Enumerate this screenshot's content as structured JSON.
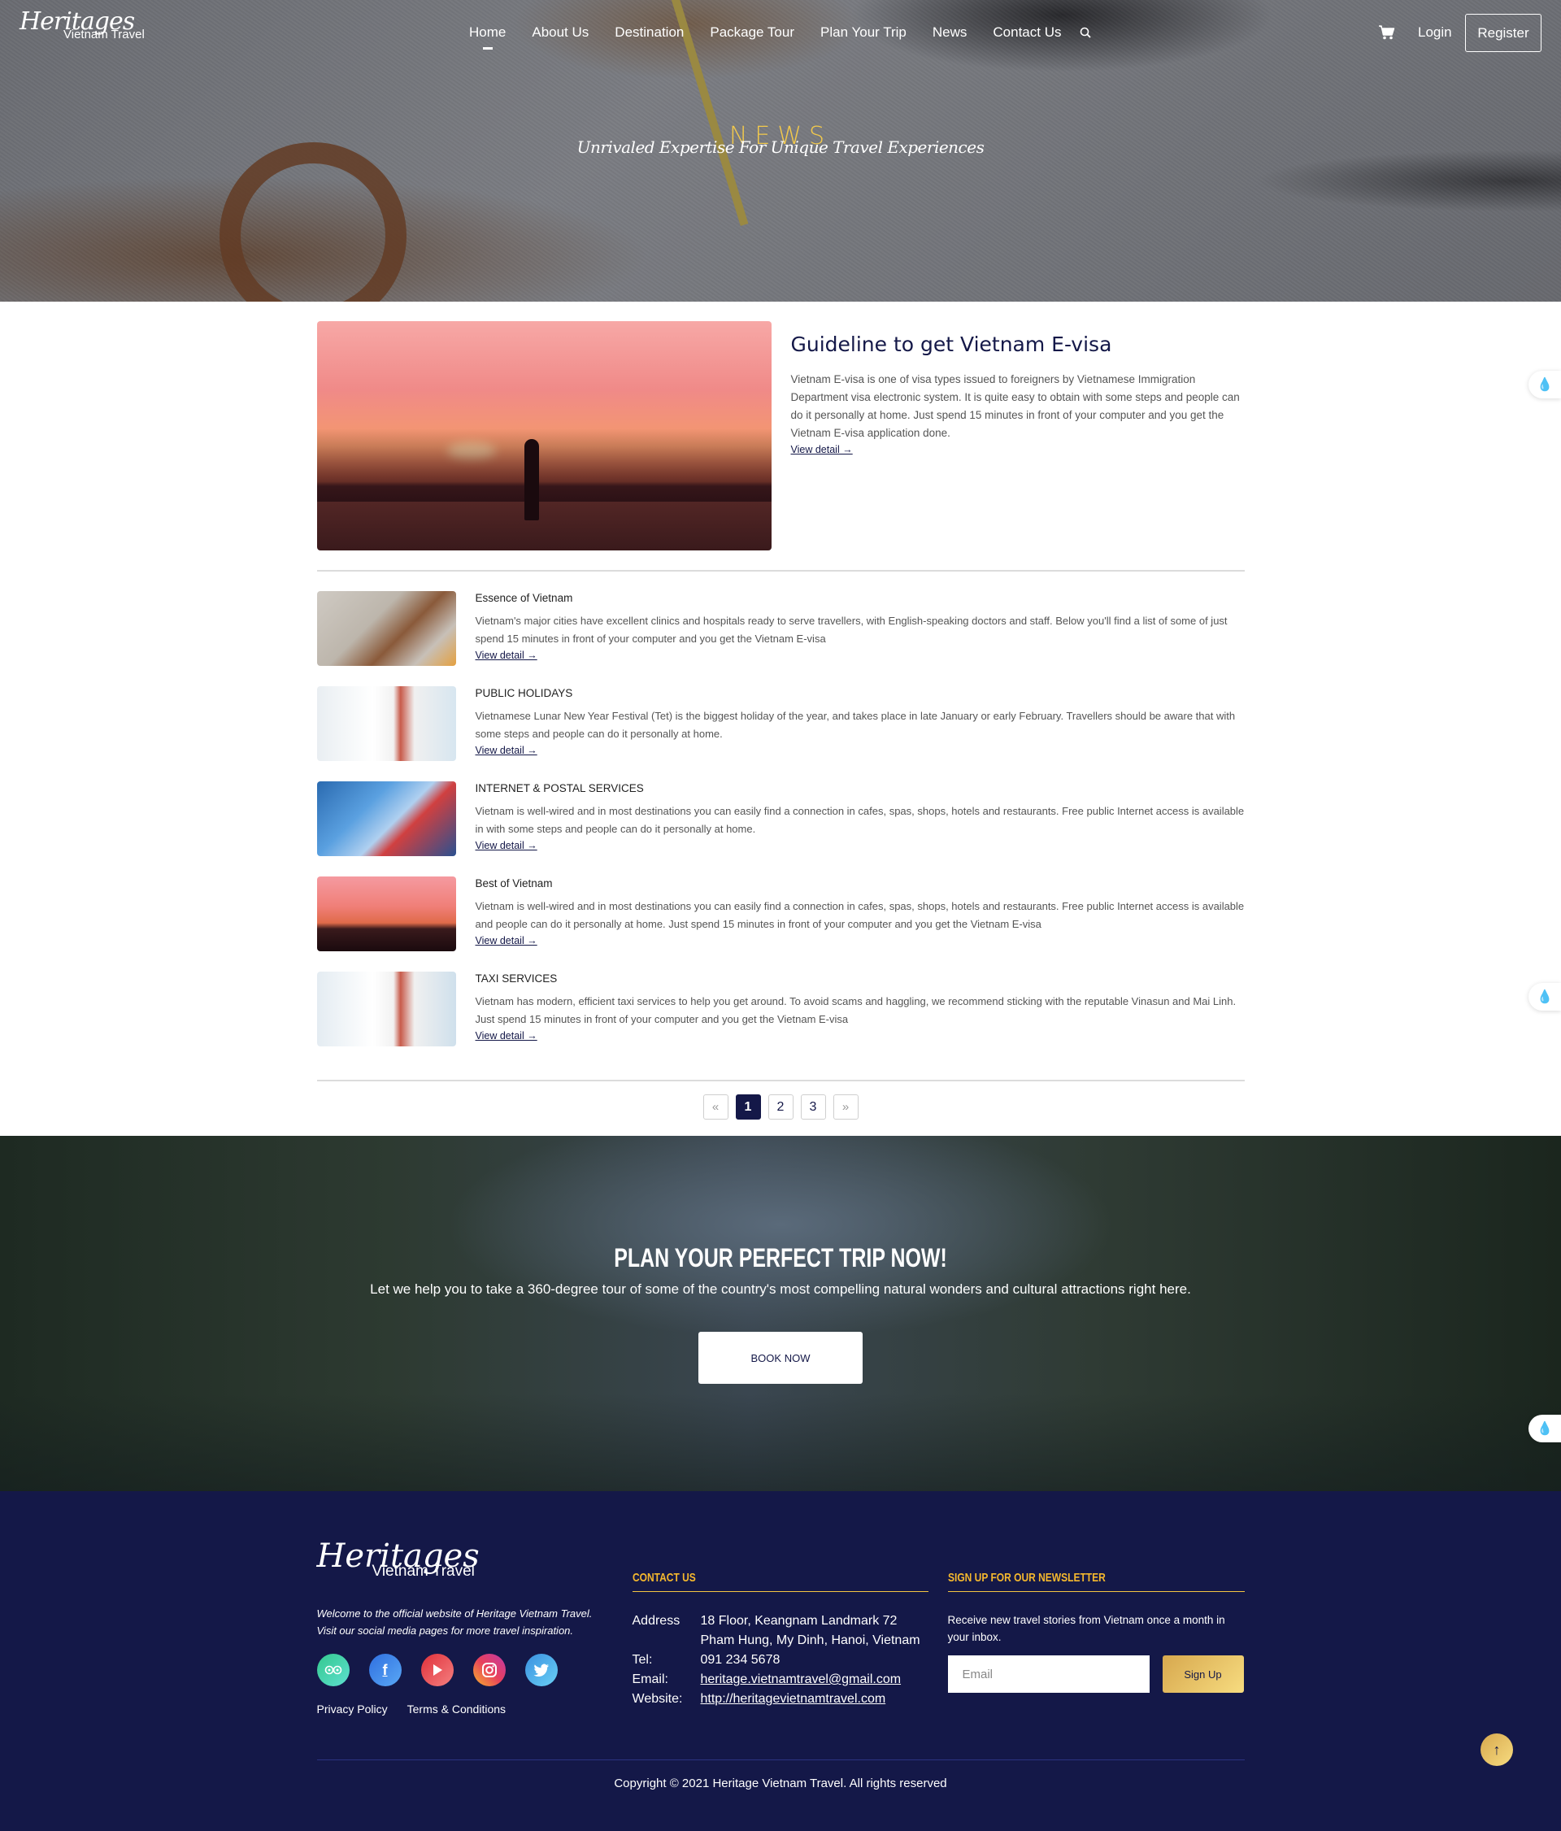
{
  "brand": {
    "script": "Heritages",
    "sub": "Vietnam Travel"
  },
  "nav": {
    "items": [
      {
        "label": "Home",
        "active": true
      },
      {
        "label": "About Us"
      },
      {
        "label": "Destination"
      },
      {
        "label": "Package Tour"
      },
      {
        "label": "Plan Your Trip"
      },
      {
        "label": "News"
      },
      {
        "label": "Contact Us"
      }
    ],
    "search_icon": "search-icon",
    "cart_icon": "cart-icon",
    "login": "Login",
    "register": "Register"
  },
  "hero": {
    "title": "NEWS",
    "subtitle": "Unrivaled Expertise For Unique Travel Experiences"
  },
  "featured": {
    "title": "Guideline to get Vietnam E-visa",
    "text": "Vietnam E-visa is one of visa types issued to foreigners by Vietnamese Immigration Department visa electronic system. It is quite easy to obtain with some steps and people can do it personally at home. Just spend 15 minutes in front of your computer and you get the Vietnam E-visa application done.",
    "link": "View detail →"
  },
  "articles": [
    {
      "title": "Essence of Vietnam",
      "text": "Vietnam's major cities have excellent clinics and hospitals ready to serve travellers, with English-speaking doctors and staff. Below you'll find a list of some of just spend 15 minutes in front of your computer and you get the Vietnam E-visa",
      "link": "View detail →"
    },
    {
      "title": "PUBLIC HOLIDAYS",
      "text": "Vietnamese Lunar New Year Festival (Tet) is the biggest holiday of the year, and takes place in late January or early February. Travellers should be aware that with some steps and people can do it personally at home.",
      "link": "View detail →"
    },
    {
      "title": "INTERNET & POSTAL SERVICES",
      "text": "Vietnam is well-wired and in most destinations you can easily find a connection in cafes, spas, shops, hotels and restaurants. Free public Internet access is available in with some steps and people can do it personally at home.",
      "link": "View detail →"
    },
    {
      "title": "Best of Vietnam",
      "text": "Vietnam is well-wired and in most destinations you can easily find a connection in cafes, spas, shops, hotels and restaurants. Free public Internet access is available and people can do it personally at home. Just spend 15 minutes in front of your computer and you get the Vietnam E-visa",
      "link": "View detail →"
    },
    {
      "title": "TAXI SERVICES",
      "text": "Vietnam has modern, efficient taxi services to help you get around. To avoid scams and haggling, we recommend sticking with the reputable Vinasun and Mai Linh. Just spend 15 minutes in front of your computer and you get the Vietnam E-visa",
      "link": "View detail →"
    }
  ],
  "pagination": {
    "prev": "«",
    "pages": [
      "1",
      "2",
      "3"
    ],
    "current": "1",
    "next": "»"
  },
  "cta": {
    "title": "PLAN YOUR PERFECT TRIP NOW!",
    "text": "Let we help you to take a 360-degree tour of some of the country's most compelling natural wonders and cultural attractions right here.",
    "button": "BOOK NOW"
  },
  "footer": {
    "welcome_line1": "Welcome to the official website of Heritage Vietnam Travel.",
    "welcome_line2": "Visit our social media pages for more travel inspiration.",
    "socials": [
      "tripadvisor-icon",
      "facebook-icon",
      "youtube-icon",
      "instagram-icon",
      "twitter-icon"
    ],
    "privacy": "Privacy Policy",
    "terms": "Terms & Conditions",
    "contact_heading": "CONTACT US",
    "contact": {
      "address_label": "Address",
      "address_line1": "18 Floor, Keangnam Landmark 72",
      "address_line2": "Pham Hung, My Dinh, Hanoi, Vietnam",
      "tel_label": "Tel:",
      "tel": "091 234 5678",
      "email_label": "Email:",
      "email": "heritage.vietnamtravel@gmail.com",
      "website_label": "Website:",
      "website": "http://heritagevietnamtravel.com"
    },
    "newsletter_heading": "SIGN UP FOR OUR NEWSLETTER",
    "newsletter_text": "Receive new travel stories from Vietnam once a month in your inbox.",
    "email_placeholder": "Email",
    "signup": "Sign Up",
    "copyright": "Copyright © 2021 Heritage Vietnam Travel. All rights reserved",
    "to_top": "↑"
  },
  "colors": {
    "navy": "#141848",
    "gold": "#f5b82e",
    "hero_title": "#f2c94c"
  }
}
